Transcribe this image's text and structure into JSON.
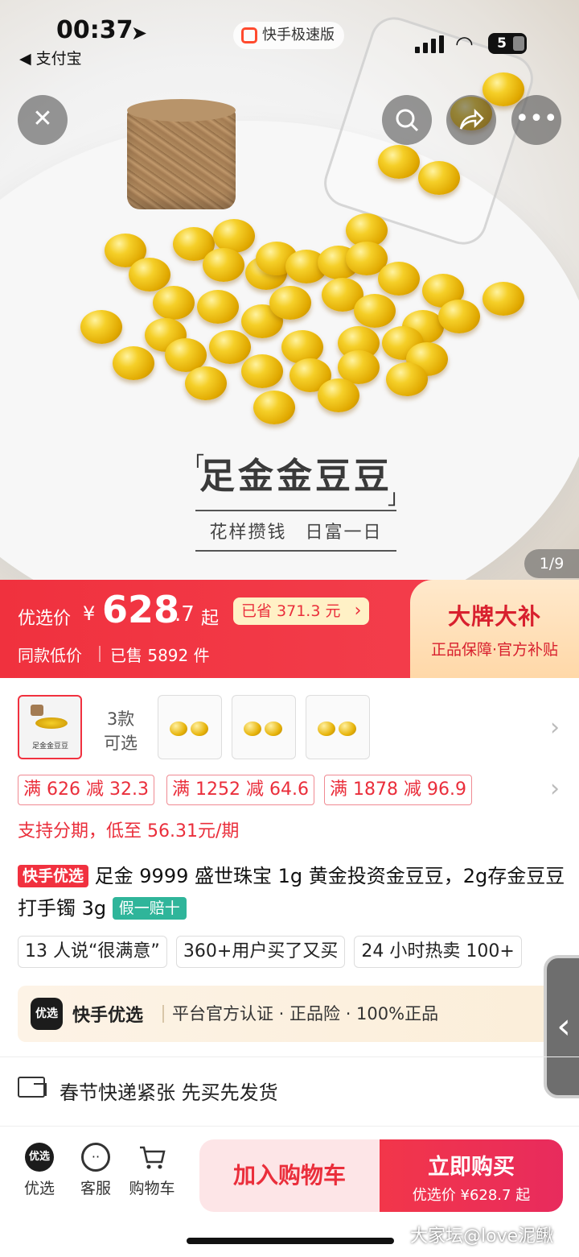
{
  "status_bar": {
    "time": "00:37",
    "back_app": "◀ 支付宝",
    "app_pill": "快手极速版",
    "battery": "5"
  },
  "hero": {
    "title": "足金金豆豆",
    "subtitle": "花样攒钱 日富一日",
    "pager": "1/9"
  },
  "price": {
    "label": "优选价",
    "currency": "¥",
    "integer": "628",
    "decimal": ".7",
    "suffix": "起",
    "saved": "已省 371.3 元",
    "low_price": "同款低价",
    "sold": "已售 5892 件",
    "brand_title": "大牌大补",
    "brand_sub": "正品保障·官方补贴"
  },
  "variants": {
    "main_caption": "足金金豆豆",
    "count_line1": "3款",
    "count_line2": "可选"
  },
  "coupons": [
    "满 626 减 32.3",
    "满 1252 减 64.6",
    "满 1878 减 96.9"
  ],
  "installment": "支持分期，低至 56.31元/期",
  "product": {
    "tag": "快手优选",
    "title": "足金 9999 盛世珠宝 1g 黄金投资金豆豆，2g存金豆豆打手镯 3g",
    "guarantee": "假一赔十"
  },
  "chips": [
    "13 人说“很满意”",
    "360+用户买了又买",
    "24 小时热卖 100+"
  ],
  "banner": {
    "logo": "优选",
    "name": "快手优选",
    "desc": "平台官方认证 · 正品险 · 100%正品"
  },
  "delivery": "春节快递紧张 先买先发货",
  "bottom_nav": {
    "items": [
      {
        "label": "优选",
        "icon": "youxuan-icon"
      },
      {
        "label": "客服",
        "icon": "service-icon"
      },
      {
        "label": "购物车",
        "icon": "cart-icon"
      }
    ],
    "add_cart": "加入购物车",
    "buy_now": "立即购买",
    "buy_price": "优选价 ¥628.7 起"
  },
  "watermark": "大家坛@love泥鳅",
  "colors": {
    "accent": "#f1313f",
    "brand_bg": "#ffe2bd",
    "guarantee": "#2fb59a"
  }
}
